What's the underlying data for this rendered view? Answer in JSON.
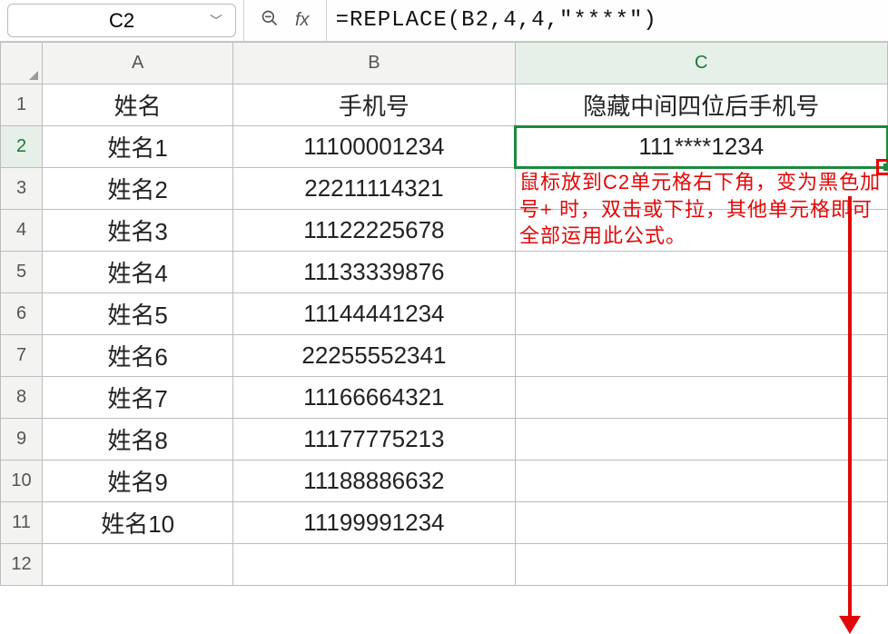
{
  "name_box": "C2",
  "formula": "=REPLACE(B2,4,4,\"****\")",
  "col_headers": [
    "A",
    "B",
    "C"
  ],
  "row_headers": [
    "1",
    "2",
    "3",
    "4",
    "5",
    "6",
    "7",
    "8",
    "9",
    "10",
    "11",
    "12"
  ],
  "header_row": {
    "A": "姓名",
    "B": "手机号",
    "C": "隐藏中间四位后手机号"
  },
  "rows": [
    {
      "A": "姓名1",
      "B": "11100001234",
      "C": "111****1234"
    },
    {
      "A": "姓名2",
      "B": "22211114321",
      "C": ""
    },
    {
      "A": "姓名3",
      "B": "11122225678",
      "C": ""
    },
    {
      "A": "姓名4",
      "B": "11133339876",
      "C": ""
    },
    {
      "A": "姓名5",
      "B": "11144441234",
      "C": ""
    },
    {
      "A": "姓名6",
      "B": "22255552341",
      "C": ""
    },
    {
      "A": "姓名7",
      "B": "11166664321",
      "C": ""
    },
    {
      "A": "姓名8",
      "B": "11177775213",
      "C": ""
    },
    {
      "A": "姓名9",
      "B": "11188886632",
      "C": ""
    },
    {
      "A": "姓名10",
      "B": "11199991234",
      "C": ""
    }
  ],
  "annotation": "鼠标放到C2单元格右下角，变为黑色加号+ 时，双击或下拉，其他单元格即可全部运用此公式。",
  "fx_label": "fx"
}
